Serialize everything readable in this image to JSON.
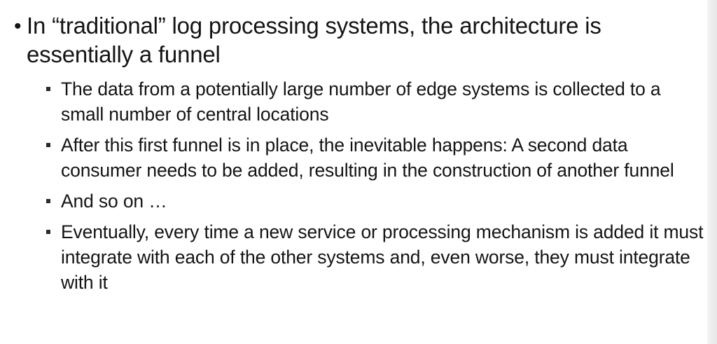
{
  "slide": {
    "main_bullet": "In “traditional” log processing systems, the architecture is essentially a funnel",
    "sub_bullets": [
      "The data from a potentially large number of edge systems is collected to a small number of central locations",
      "After this first funnel is in place, the inevitable happens: A second data consumer needs to be added, resulting in the construction of another funnel",
      "And so on …",
      "Eventually, every time a new service or processing mechanism is added it must integrate with each of the other systems and, even worse, they must integrate with it"
    ]
  }
}
